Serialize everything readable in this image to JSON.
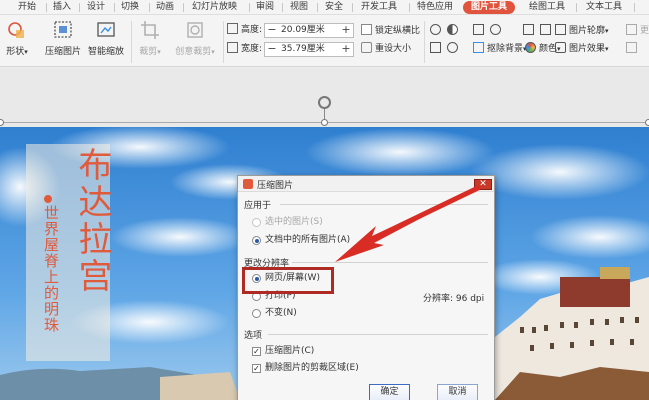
{
  "menu": {
    "tabs": [
      "开始",
      "插入",
      "设计",
      "切换",
      "动画",
      "幻灯片放映",
      "审阅",
      "视图",
      "安全",
      "开发工具",
      "特色应用",
      "图片工具",
      "绘图工具",
      "文本工具"
    ],
    "active": "图片工具"
  },
  "ribbon": {
    "shape": "形状",
    "compress": "压缩图片",
    "smart_zoom": "智能缩放",
    "crop": "裁剪",
    "creative_crop": "创意裁剪",
    "height_label": "高度:",
    "height_value": "20.09厘米",
    "width_label": "宽度:",
    "width_value": "35.79厘米",
    "lock_ratio": "锁定纵横比",
    "reset_size": "重设大小",
    "remove_bg": "抠除背景",
    "color": "颜色",
    "outline": "图片轮廓",
    "effects": "图片效果",
    "reset": "更"
  },
  "slide": {
    "title": "布达拉宫",
    "subtitle": "世界屋脊上的明珠"
  },
  "dialog": {
    "title": "压缩图片",
    "apply_group": "应用于",
    "opt_selected": "选中的图片(S)",
    "opt_all": "文档中的所有图片(A)",
    "resolution_group": "更改分辨率",
    "opt_web": "网页/屏幕(W)",
    "opt_print": "打印(P)",
    "opt_none": "不变(N)",
    "resolution_text": "分辨率: 96 dpi",
    "options_group": "选项",
    "chk_compress": "压缩图片(C)",
    "chk_delete_crop": "删除图片的剪裁区域(E)",
    "ok": "确定",
    "cancel": "取消"
  },
  "colors": {
    "accent": "#e0533c",
    "highlight": "#b02a24",
    "title_text": "#e05a3c"
  }
}
